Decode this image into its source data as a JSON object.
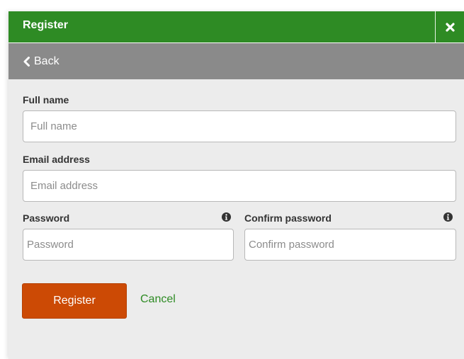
{
  "dialog": {
    "title": "Register",
    "close_icon": "close-icon",
    "back_label": "Back",
    "back_icon": "chevron-left-icon"
  },
  "form": {
    "full_name": {
      "label": "Full name",
      "placeholder": "Full name",
      "value": ""
    },
    "email": {
      "label": "Email address",
      "placeholder": "Email address",
      "value": ""
    },
    "password": {
      "label": "Password",
      "placeholder": "Password",
      "value": "",
      "icon": "info-icon"
    },
    "confirm_password": {
      "label": "Confirm password",
      "placeholder": "Confirm password",
      "value": "",
      "icon": "info-icon"
    }
  },
  "actions": {
    "register_label": "Register",
    "cancel_label": "Cancel"
  },
  "colors": {
    "header_green": "#2e8b24",
    "nav_gray": "#8a8a8a",
    "register_orange": "#cc4a05",
    "link_green": "#2e8b24",
    "panel_bg": "#ececec"
  }
}
